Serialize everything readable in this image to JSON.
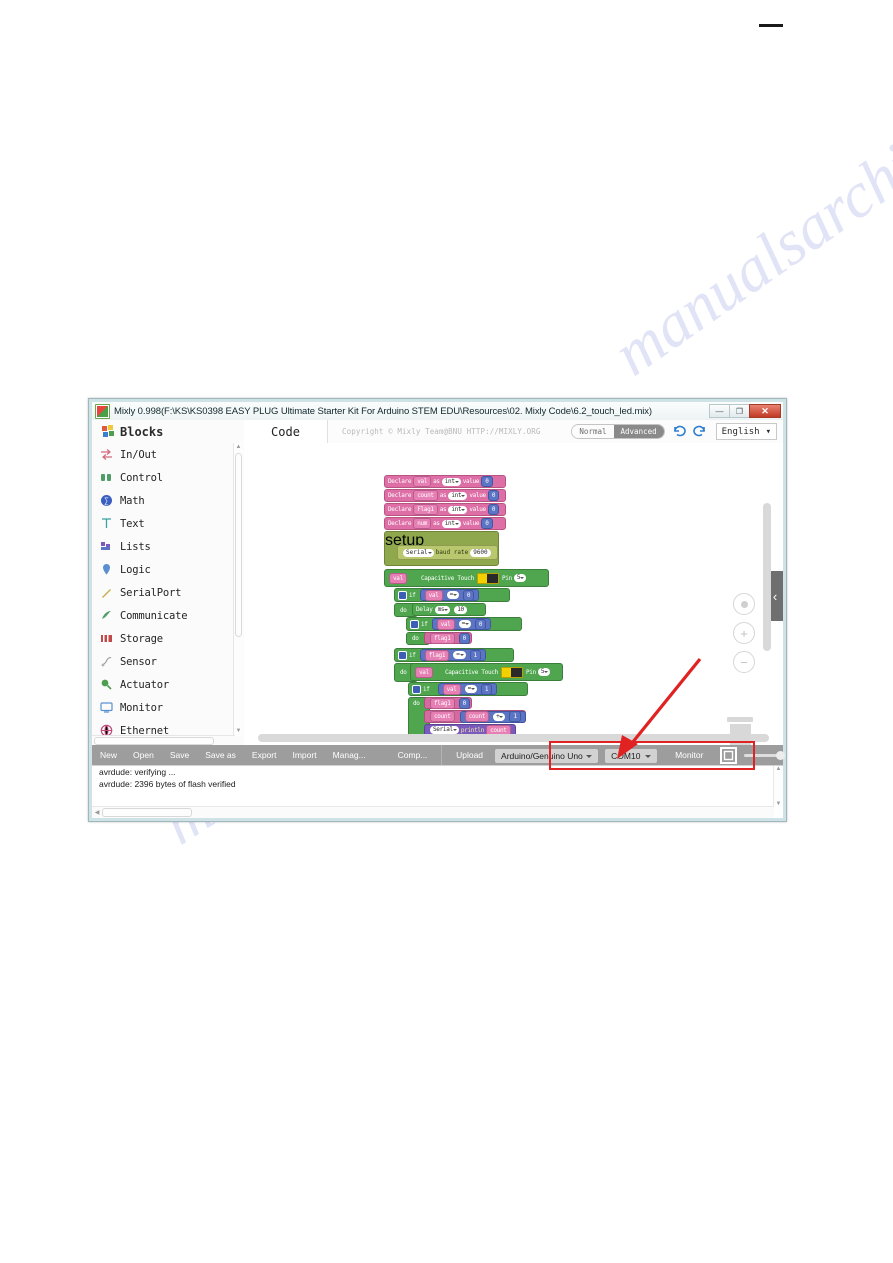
{
  "window": {
    "title": "Mixly 0.998(F:\\KS\\KS0398 EASY PLUG Ultimate Starter Kit For Arduino STEM EDU\\Resources\\02. Mixly Code\\6.2_touch_led.mix)",
    "app_icon": "mixly-icon",
    "controls": {
      "minimize": "—",
      "maximize": "❐",
      "close": "✕"
    }
  },
  "sidebar": {
    "header": {
      "label": "Blocks",
      "icon": "blocks-icon"
    },
    "items": [
      {
        "label": "In/Out",
        "icon": "inout-icon",
        "color": "#d16a7e"
      },
      {
        "label": "Control",
        "icon": "control-icon",
        "color": "#4f9e6a"
      },
      {
        "label": "Math",
        "icon": "math-icon",
        "color": "#3b5fc0"
      },
      {
        "label": "Text",
        "icon": "text-icon",
        "color": "#3aa0a0"
      },
      {
        "label": "Lists",
        "icon": "lists-icon",
        "color": "#7a5bbd"
      },
      {
        "label": "Logic",
        "icon": "logic-icon",
        "color": "#5b8fd0"
      },
      {
        "label": "SerialPort",
        "icon": "serialport-icon",
        "color": "#c8b04a"
      },
      {
        "label": "Communicate",
        "icon": "communicate-icon",
        "color": "#4f9e6a"
      },
      {
        "label": "Storage",
        "icon": "storage-icon",
        "color": "#c04a4a"
      },
      {
        "label": "Sensor",
        "icon": "sensor-icon",
        "color": "#a0a0a0"
      },
      {
        "label": "Actuator",
        "icon": "actuator-icon",
        "color": "#4f9e4f"
      },
      {
        "label": "Monitor",
        "icon": "monitor-icon",
        "color": "#5b8fd0"
      },
      {
        "label": "Ethernet",
        "icon": "ethernet-icon",
        "color": "#c04a7a"
      }
    ]
  },
  "topbar": {
    "code_tab": "Code",
    "copyright": "Copyright © Mixly Team@BNU HTTP://MIXLY.ORG",
    "mode": {
      "normal": "Normal",
      "advanced": "Advanced",
      "selected": "Advanced"
    },
    "undo_icon": "undo-icon",
    "redo_icon": "redo-icon",
    "language": "English"
  },
  "canvas": {
    "declares": [
      {
        "text": "Declare",
        "name": "val",
        "as": "as",
        "type": "int",
        "value_label": "value",
        "value": "0"
      },
      {
        "text": "Declare",
        "name": "count",
        "as": "as",
        "type": "int",
        "value_label": "value",
        "value": "0"
      },
      {
        "text": "Declare",
        "name": "Flag1",
        "as": "as",
        "type": "int",
        "value_label": "value",
        "value": "0"
      },
      {
        "text": "Declare",
        "name": "num",
        "as": "as",
        "type": "int",
        "value_label": "value",
        "value": "0"
      }
    ],
    "setup": {
      "header": "setup",
      "serial": "Serial",
      "baud_label": "baud rate",
      "baud": "9600"
    },
    "blocks": {
      "touch_assign_1": {
        "var": "val",
        "label": "Capacitive Touch",
        "pin_label": "Pin",
        "pin": "5",
        "image": "touch-sensor-image"
      },
      "if_1": {
        "if": "if",
        "do": "do",
        "left": "val",
        "op": "=",
        "right": "0"
      },
      "delay": {
        "label": "Delay",
        "unit": "ms",
        "value": "10"
      },
      "if_2": {
        "if": "if",
        "do": "do",
        "left": "val",
        "op": "=",
        "right": "0"
      },
      "set_flag_1": {
        "var": "flag1",
        "value": "0"
      },
      "if_3": {
        "if": "if",
        "do": "do",
        "left": "flag1",
        "op": "=",
        "right": "1"
      },
      "touch_assign_2": {
        "var": "val",
        "label": "Capacitive Touch",
        "pin_label": "Pin",
        "pin": "5",
        "image": "touch-sensor-image"
      },
      "if_4": {
        "if": "if",
        "do": "do",
        "left": "val",
        "op": "=",
        "right": "1"
      },
      "set_flag_2": {
        "var": "flag1",
        "value": "0"
      },
      "set_count": {
        "var": "count",
        "left": "count",
        "op": "+",
        "right": "1"
      },
      "serial_print": {
        "serial": "Serial",
        "method": "println",
        "arg": "count"
      }
    },
    "zoom_controls": {
      "center": "center-icon",
      "zoom_in": "+",
      "zoom_out": "−",
      "trash": "trash-icon",
      "collapse": "‹"
    }
  },
  "toolbar": {
    "buttons": [
      "New",
      "Open",
      "Save",
      "Save as",
      "Export",
      "Import",
      "Manag...",
      "Comp..."
    ],
    "upload": "Upload",
    "board": "Arduino/Genuino Uno",
    "port": "COM10",
    "monitor": "Monitor",
    "chip_icon": "chip-icon",
    "highlight_color": "#e02222"
  },
  "console": {
    "lines": [
      "avrdude: verifying ...",
      "avrdude: 2396 bytes of flash verified"
    ]
  },
  "annotation": {
    "arrow": "red-arrow-pointing-to-port-selector",
    "color": "#e02222"
  },
  "watermark": {
    "text_1": "manualsarchive.com",
    "text_2": "manualsarchive.com"
  }
}
